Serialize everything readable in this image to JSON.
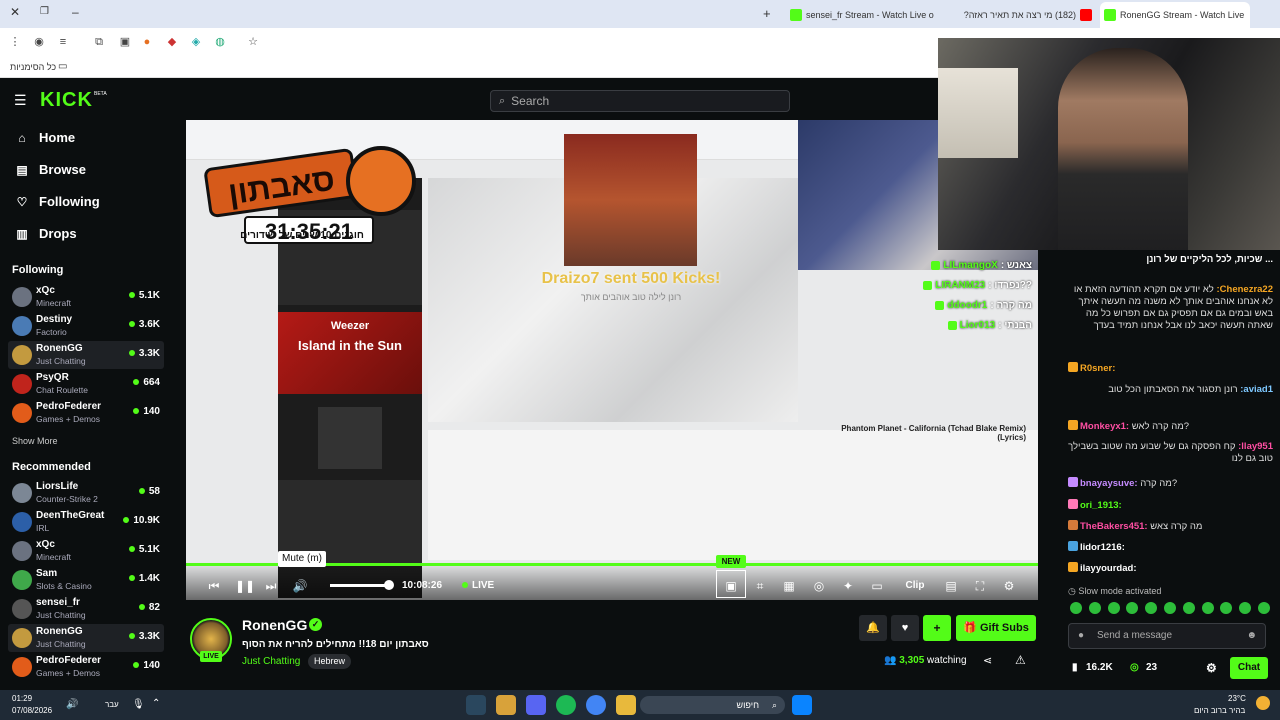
{
  "browser": {
    "tabs": [
      {
        "title": "sensei_fr Stream - Watch Live o"
      },
      {
        "title": "(182) מי רצה את תאיר ראזה?"
      },
      {
        "title": "RonenGG Stream - Watch Live"
      }
    ],
    "bookmarks_label": "כל הסימניות"
  },
  "header": {
    "logo": "KICK",
    "logo_badge": "BETA",
    "search_placeholder": "Search"
  },
  "sidebar": {
    "nav": [
      {
        "label": "Home"
      },
      {
        "label": "Browse"
      },
      {
        "label": "Following"
      },
      {
        "label": "Drops"
      }
    ],
    "following_title": "Following",
    "following": [
      {
        "name": "xQc",
        "game": "Minecraft",
        "viewers": "5.1K"
      },
      {
        "name": "Destiny",
        "game": "Factorio",
        "viewers": "3.6K"
      },
      {
        "name": "RonenGG",
        "game": "Just Chatting",
        "viewers": "3.3K"
      },
      {
        "name": "PsyQR",
        "game": "Chat Roulette",
        "viewers": "664"
      },
      {
        "name": "PedroFederer",
        "game": "Games + Demos",
        "viewers": "140"
      }
    ],
    "show_more": "Show More",
    "recommended_title": "Recommended",
    "recommended": [
      {
        "name": "LiorsLife",
        "game": "Counter-Strike 2",
        "viewers": "58"
      },
      {
        "name": "DeenTheGreat",
        "game": "IRL",
        "viewers": "10.9K"
      },
      {
        "name": "xQc",
        "game": "Minecraft",
        "viewers": "5.1K"
      },
      {
        "name": "Sam",
        "game": "Slots & Casino",
        "viewers": "1.4K"
      },
      {
        "name": "sensei_fr",
        "game": "Just Chatting",
        "viewers": "82"
      },
      {
        "name": "RonenGG",
        "game": "Just Chatting",
        "viewers": "3.3K"
      },
      {
        "name": "PedroFederer",
        "game": "Games + Demos",
        "viewers": "140"
      }
    ]
  },
  "player": {
    "timer_title": "סאבתון",
    "timer_time": "31:35:21",
    "timer_sub": "חוגגים 10 שנים של שידורים",
    "weezer_artist": "Weezer",
    "weezer_song": "Island in the Sun",
    "alert_text": "Draizo7 sent 500 Kicks!",
    "alert_sub": "רונן לילה טוב אוהבים אותך",
    "song_caption": "Phantom Planet - California (Tchad Blake Remix) (Lyrics)",
    "overlay_chat": [
      {
        "user": "LILmangoX",
        "text": ": צאנש"
      },
      {
        "user": "LIRANM23",
        "text": ": נפרדו??"
      },
      {
        "user": "ddoodr1",
        "text": ": מה קרה"
      },
      {
        "user": "Lior013",
        "text": ": הבנתי"
      }
    ],
    "controls": {
      "time": "10:08:26",
      "live": "LIVE",
      "mute_tooltip": "Mute (m)",
      "new_badge": "NEW",
      "clip_label": "Clip"
    }
  },
  "stream": {
    "channel": "RonenGG",
    "live_chip": "LIVE",
    "title": "סאבתון יום 18!! מתחילים להריח את הסוף",
    "category": "Just Chatting",
    "language": "Hebrew",
    "viewers": "3,305",
    "viewers_suffix": "watching",
    "gift_label": "Gift Subs"
  },
  "chat": {
    "pinned": "שכיות, לכל הליקיים של רונן ...",
    "messages": [
      {
        "user": "Chenezra22:",
        "text": "לא יודע אם תקרא תהודעה הזאת או לא אנחנו אוהבים אותך לא משנה מה תעשה איתך באש ובמים גם אם תפסיק גם אם תפרוש כל מה שאתה תעשה יכאב לנו אבל אנחנו תמיד בעדך",
        "color": "#f5a623"
      },
      {
        "user": "R0sner:",
        "text": "",
        "color": "#f5a623"
      },
      {
        "user": "aviad1:",
        "text": "רונן תסגור את הסאבתון הכל טוב",
        "color": "#7ec8ff"
      },
      {
        "user": "Monkeyx1:",
        "text": "מה קרה לאש?",
        "color": "#ff4fa3"
      },
      {
        "user": "llay951:",
        "text": "קח הפסקה גם של שבוע מה שטוב בשבילך טוב גם לנו",
        "color": "#ff4fa3"
      },
      {
        "user": "bnayaysuve:",
        "text": "מה קרה?",
        "color": "#c58bff"
      },
      {
        "user": "ori_1913:",
        "text": "",
        "color": "#53fc18"
      },
      {
        "user": "TheBakers451:",
        "text": "מה קרה צאש",
        "color": "#ff4fa3"
      },
      {
        "user": "lidor1216:",
        "text": "",
        "color": "#ffffff"
      },
      {
        "user": "ilayyourdad:",
        "text": "",
        "color": "#ffffff"
      }
    ],
    "slow_mode": "Slow mode activated",
    "send_placeholder": "Send a message",
    "foot_viewers": "16.2K",
    "foot_points": "23",
    "chat_button": "Chat"
  },
  "taskbar": {
    "time": "01:29",
    "date": "07/08/2026",
    "lang": "עבר",
    "search": "חיפוש",
    "weather_temp": "23°C",
    "weather_desc": "בהיר ברוב היום"
  }
}
